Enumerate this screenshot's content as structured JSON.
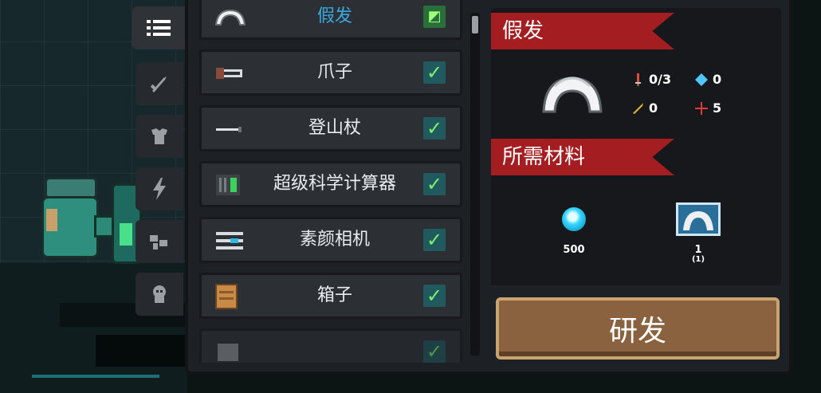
{
  "equipment_list": {
    "items": [
      {
        "name": "假发",
        "checked": false,
        "selected": true,
        "icon": "wig-icon"
      },
      {
        "name": "爪子",
        "checked": true,
        "icon": "claw-icon"
      },
      {
        "name": "登山杖",
        "checked": true,
        "icon": "trekking-pole-icon"
      },
      {
        "name": "超级科学计算器",
        "checked": true,
        "icon": "calculator-icon"
      },
      {
        "name": "素颜相机",
        "checked": true,
        "icon": "camera-icon"
      },
      {
        "name": "箱子",
        "checked": true,
        "icon": "box-icon"
      },
      {
        "name": "",
        "checked": true,
        "icon": "partial-item-icon",
        "partial": true
      }
    ]
  },
  "side_tabs": [
    {
      "icon": "list-icon",
      "active": true
    },
    {
      "icon": "weapon-icon",
      "active": false
    },
    {
      "icon": "armor-icon",
      "active": false
    },
    {
      "icon": "lightning-icon",
      "active": false
    },
    {
      "icon": "plant-icon",
      "active": false
    },
    {
      "icon": "pet-icon",
      "active": false
    }
  ],
  "details": {
    "item_name": "假发",
    "stats": {
      "attack": "0/3",
      "energy": "0",
      "crit": "0",
      "precision": "5"
    },
    "materials_title": "所需材料",
    "materials": [
      {
        "icon": "gem-icon",
        "amount": "500"
      },
      {
        "icon": "wig-material-icon",
        "amount": "1",
        "sub": "(1)"
      }
    ],
    "research_button": "研发"
  },
  "colors": {
    "ribbon": "#a31d21",
    "button": "#8a6240",
    "check": "#7bf36b",
    "selected_text": "#3aa9e0"
  }
}
